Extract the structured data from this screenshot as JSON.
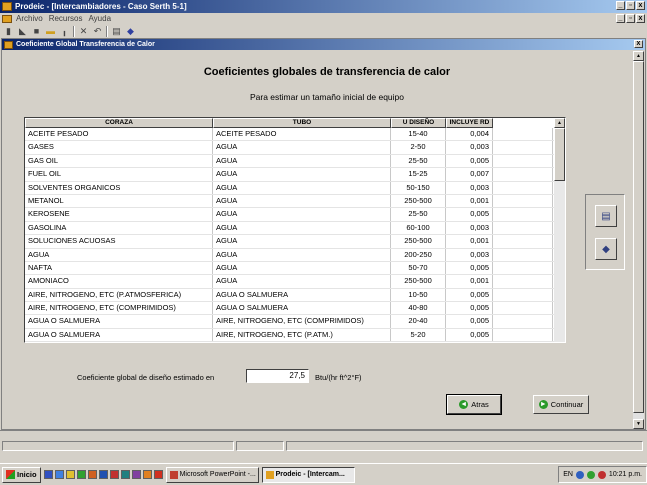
{
  "app": {
    "title": "Prodeic - [Intercambiadores - Caso Serth 5-1]",
    "menu": [
      "Archivo",
      "Recursos",
      "Ayuda"
    ],
    "toolbar_icons": [
      "new-icon",
      "open-icon",
      "save-icon",
      "folder-icon",
      "chart-icon",
      "delete-icon",
      "undo-icon",
      "calculator-icon",
      "eraser-icon"
    ]
  },
  "child": {
    "title": "Coeficiente Global Transferencia de Calor",
    "heading": "Coeficientes globales de transferencia de calor",
    "subheading": "Para estimar un tamaño inicial de equipo"
  },
  "grid": {
    "columns": [
      "CORAZA",
      "TUBO",
      "U DISEÑO",
      "INCLUYE RD"
    ],
    "rows": [
      [
        "ACEITE PESADO",
        "ACEITE PESADO",
        "15-40",
        "0,004"
      ],
      [
        "GASES",
        "AGUA",
        "2-50",
        "0,003"
      ],
      [
        "GAS OIL",
        "AGUA",
        "25-50",
        "0,005"
      ],
      [
        "FUEL OIL",
        "AGUA",
        "15-25",
        "0,007"
      ],
      [
        "SOLVENTES ORGANICOS",
        "AGUA",
        "50-150",
        "0,003"
      ],
      [
        "METANOL",
        "AGUA",
        "250-500",
        "0,001"
      ],
      [
        "KEROSENE",
        "AGUA",
        "25-50",
        "0,005"
      ],
      [
        "GASOLINA",
        "AGUA",
        "60-100",
        "0,003"
      ],
      [
        "SOLUCIONES ACUOSAS",
        "AGUA",
        "250-500",
        "0,001"
      ],
      [
        "AGUA",
        "AGUA",
        "200-250",
        "0,003"
      ],
      [
        "NAFTA",
        "AGUA",
        "50-70",
        "0,005"
      ],
      [
        "AMONIACO",
        "AGUA",
        "250-500",
        "0,001"
      ],
      [
        "AIRE, NITROGENO, ETC (P.ATMOSFERICA)",
        "AGUA O SALMUERA",
        "10-50",
        "0,005"
      ],
      [
        "AIRE, NITROGENO, ETC (COMPRIMIDOS)",
        "AGUA O SALMUERA",
        "40-80",
        "0,005"
      ],
      [
        "AGUA O SALMUERA",
        "AIRE, NITROGENO, ETC (COMPRIMIDOS)",
        "20-40",
        "0,005"
      ],
      [
        "AGUA O SALMUERA",
        "AIRE, NITROGENO, ETC (P.ATM.)",
        "5-20",
        "0,005"
      ]
    ]
  },
  "estimate": {
    "label": "Coeficiente global de diseño estimado en",
    "value": "27,5",
    "unit": "Btu/(hr ft^2°F)"
  },
  "buttons": {
    "back": "Atras",
    "continue": "Continuar"
  },
  "taskbar": {
    "start": "Inicio",
    "tasks": [
      "Microsoft PowerPoint -...",
      "Prodeic - [Intercam..."
    ],
    "lang": "EN",
    "clock": "10:21 p.m."
  }
}
